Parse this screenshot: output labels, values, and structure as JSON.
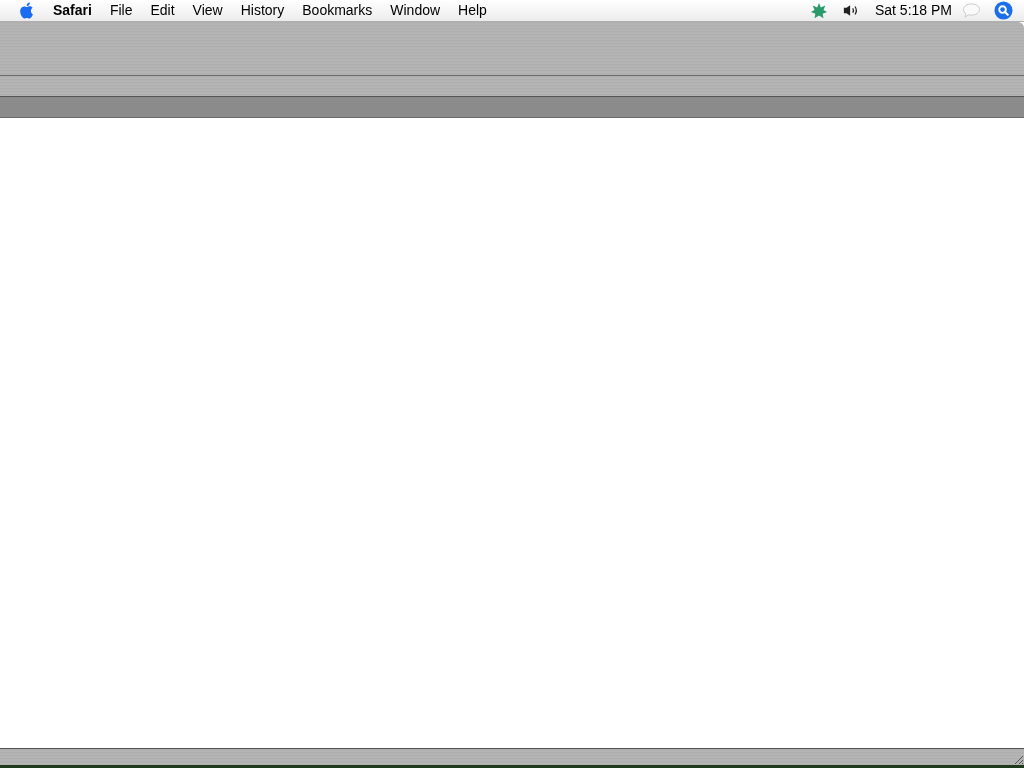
{
  "menu_bar": {
    "app_name": "Safari",
    "menus": [
      "File",
      "Edit",
      "View",
      "History",
      "Bookmarks",
      "Window",
      "Help"
    ],
    "clock": "Sat 5:18 PM"
  }
}
